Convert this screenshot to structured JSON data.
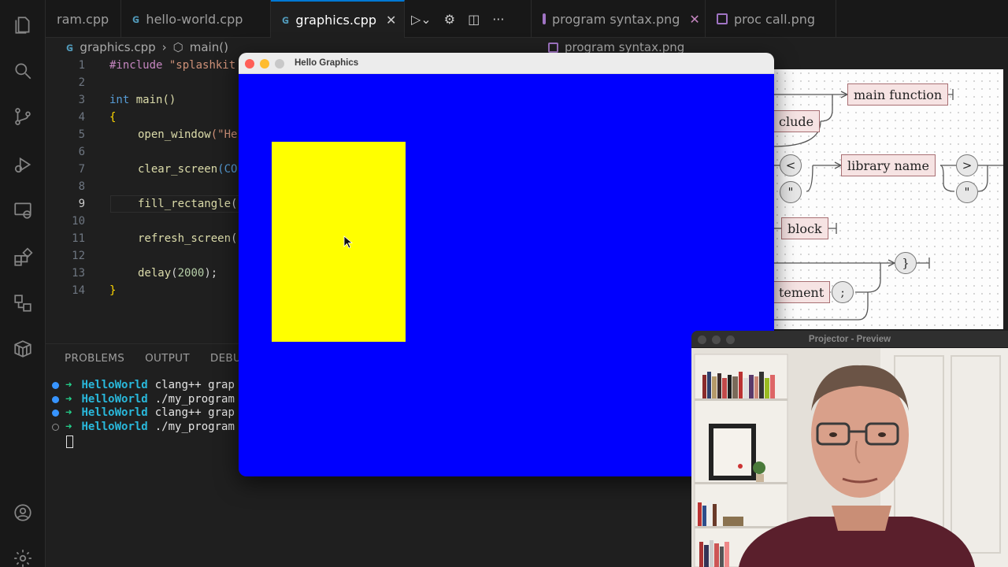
{
  "tabs": [
    {
      "label": "ram.cpp",
      "type": "cpp"
    },
    {
      "label": "hello-world.cpp",
      "type": "cpp"
    },
    {
      "label": "graphics.cpp",
      "type": "cpp",
      "active": true
    },
    {
      "label": "program syntax.png",
      "type": "png"
    },
    {
      "label": "proc call.png",
      "type": "png"
    }
  ],
  "tab_icons": {
    "cpp": "C++",
    "close": "✕"
  },
  "breadcrumb": {
    "file": "graphics.cpp",
    "symbol": "main()"
  },
  "image_breadcrumb": "program syntax.png",
  "code_lines": [
    {
      "n": "1"
    },
    {
      "n": "2"
    },
    {
      "n": "3"
    },
    {
      "n": "4"
    },
    {
      "n": "5"
    },
    {
      "n": "6"
    },
    {
      "n": "7"
    },
    {
      "n": "8"
    },
    {
      "n": "9"
    },
    {
      "n": "10"
    },
    {
      "n": "11"
    },
    {
      "n": "12"
    },
    {
      "n": "13"
    },
    {
      "n": "14"
    }
  ],
  "code": {
    "l1_dir": "#include",
    "l1_str": " \"splashkit",
    "l3_kw": "int",
    "l3_rest": " main()",
    "l4": "{",
    "l5_fn": "open_window",
    "l5_str": "(\"He",
    "l7_fn": "clear_screen",
    "l7_rest": "(CO",
    "l9_fn": "fill_rectangle",
    "l9_rest": "(",
    "l11_fn": "refresh_screen",
    "l11_rest": "(",
    "l13_fn": "delay",
    "l13_open": "(",
    "l13_num": "2000",
    "l13_close": ");",
    "l14": "}"
  },
  "panel": {
    "tabs": [
      "PROBLEMS",
      "OUTPUT",
      "DEBU"
    ],
    "terminal": [
      {
        "dir": "HelloWorld",
        "cmd": "clang++ grap",
        "status": "ok"
      },
      {
        "dir": "HelloWorld",
        "cmd": "./my_program",
        "status": "ok"
      },
      {
        "dir": "HelloWorld",
        "cmd": "clang++ grap",
        "status": "ok"
      },
      {
        "dir": "HelloWorld",
        "cmd": "./my_program",
        "status": "pending"
      }
    ],
    "prompt_arrow": "➜"
  },
  "syntax_diagram": {
    "boxes": {
      "main_function": "main function",
      "include": "clude",
      "library_name": "library name",
      "block": "block",
      "statement": "tement"
    },
    "circles": {
      "lt": "<",
      "q1": "\"",
      "gt": ">",
      "q2": "\"",
      "close_brace": "}",
      "semicolon": ";"
    }
  },
  "graphics_window": {
    "title": "Hello Graphics",
    "background_color": "#0000ff",
    "rect_color": "#ffff00"
  },
  "projector": {
    "title": "Projector - Preview"
  }
}
